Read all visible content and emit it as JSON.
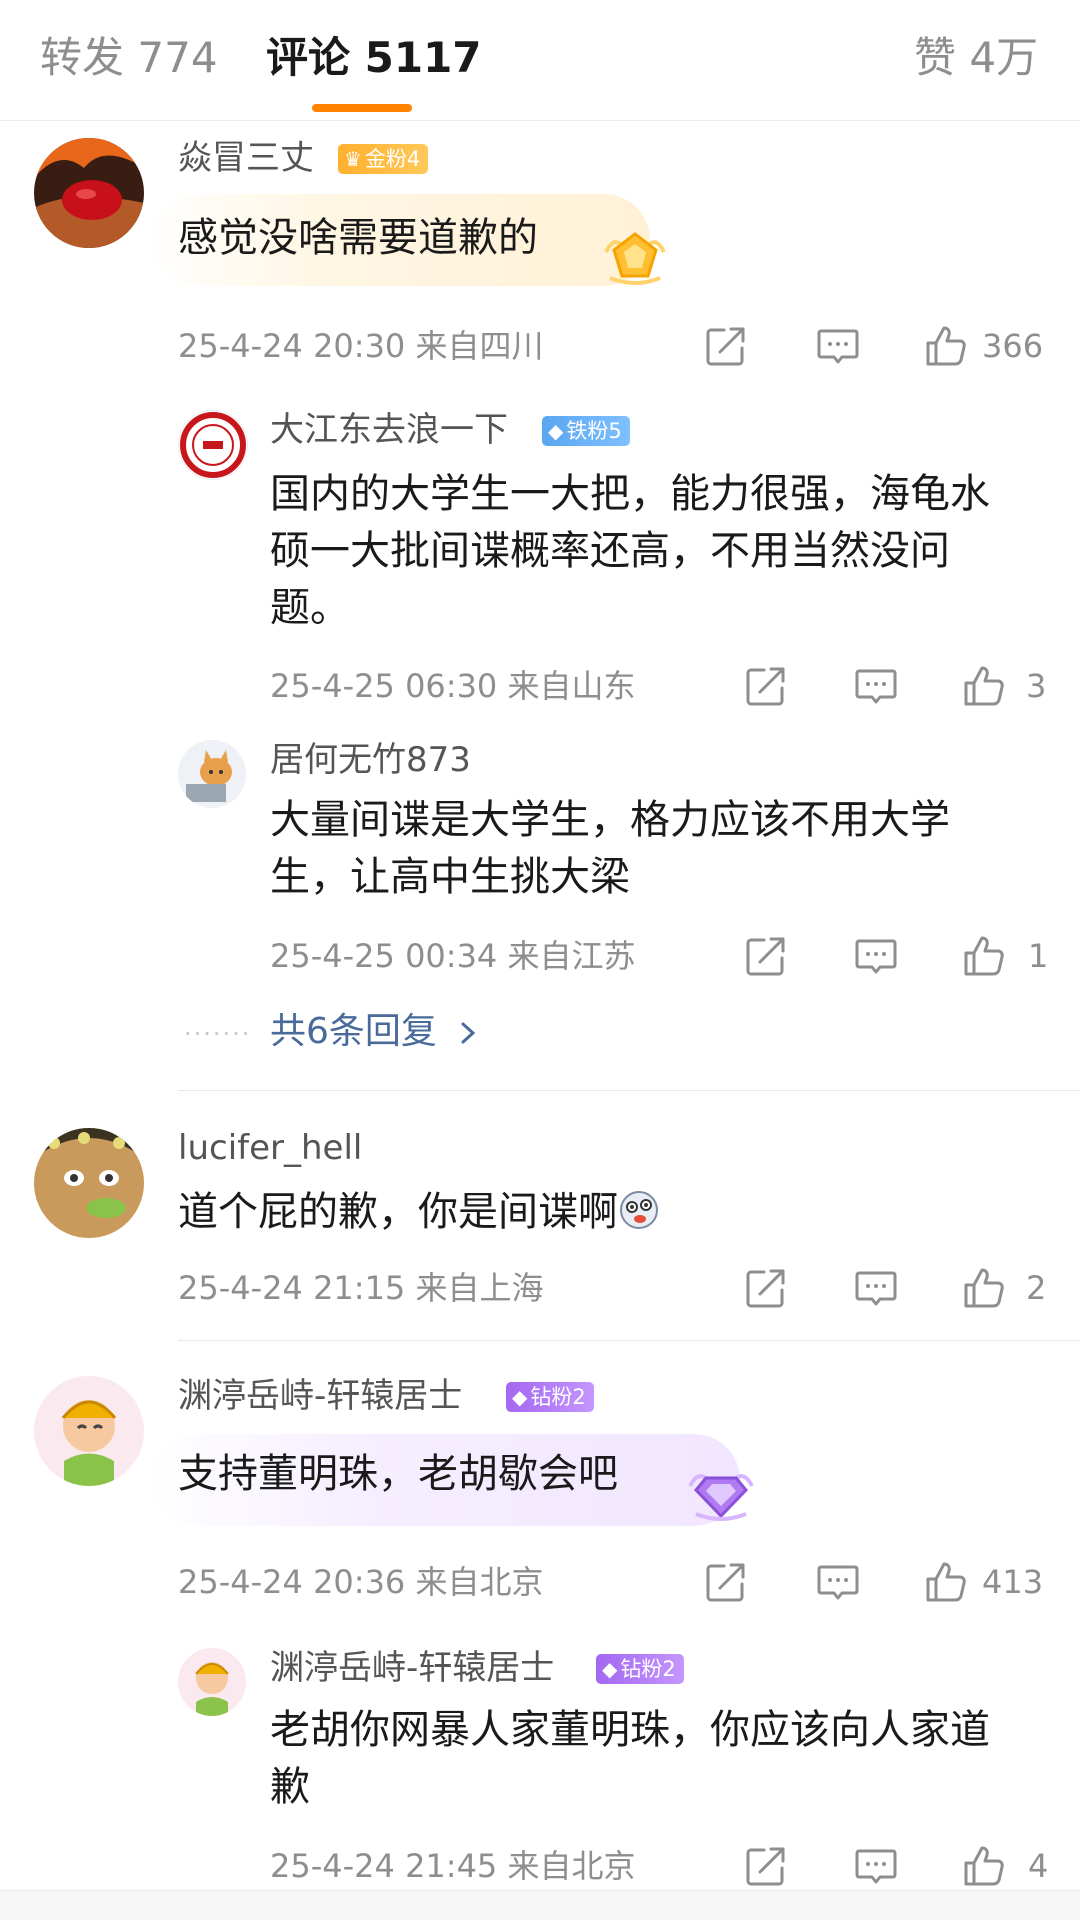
{
  "tabs": {
    "repost": {
      "label": "转发",
      "count": "774"
    },
    "comments": {
      "label": "评论",
      "count": "5117"
    },
    "likes": {
      "label": "赞",
      "count": "4万"
    }
  },
  "comments": [
    {
      "username": "焱冒三丈",
      "badge": "金粉4",
      "text": "感觉没啥需要道歉的",
      "meta": "25-4-24 20:30 来自四川",
      "likes": "366",
      "replies": [
        {
          "username": "大江东去浪一下",
          "badge": "铁粉5",
          "text": "国内的大学生一大把，能力很强，海龟水硕一大批间谍概率还高，不用当然没问题。",
          "meta": "25-4-25 06:30 来自山东",
          "likes": "3"
        },
        {
          "username": "居何无竹873",
          "badge": "",
          "text": "大量间谍是大学生，格力应该不用大学生，让高中生挑大梁",
          "meta": "25-4-25 00:34 来自江苏",
          "likes": "1"
        }
      ],
      "more_replies": "共6条回复"
    },
    {
      "username": "lucifer_hell",
      "badge": "",
      "text": "道个屁的歉，你是间谍啊",
      "meta": "25-4-24 21:15 来自上海",
      "likes": "2"
    },
    {
      "username": "渊渟岳峙-轩辕居士",
      "badge": "钻粉2",
      "text": "支持董明珠，老胡歇会吧",
      "meta": "25-4-24 20:36 来自北京",
      "likes": "413",
      "replies": [
        {
          "username": "渊渟岳峙-轩辕居士",
          "badge": "钻粉2",
          "text": "老胡你网暴人家董明珠，你应该向人家道歉",
          "meta": "25-4-24 21:45 来自北京",
          "likes": "4"
        }
      ]
    }
  ],
  "colors": {
    "accent": "#ff8200",
    "link": "#4a6a9a",
    "gold_badge": "#ffb02e",
    "iron_badge": "#5aa6f0",
    "diamond_badge": "#a368f0"
  },
  "icons": [
    "share-icon",
    "comment-icon",
    "like-icon",
    "diamond-gem-icon",
    "chevron-right-icon",
    "emoji-icon"
  ]
}
